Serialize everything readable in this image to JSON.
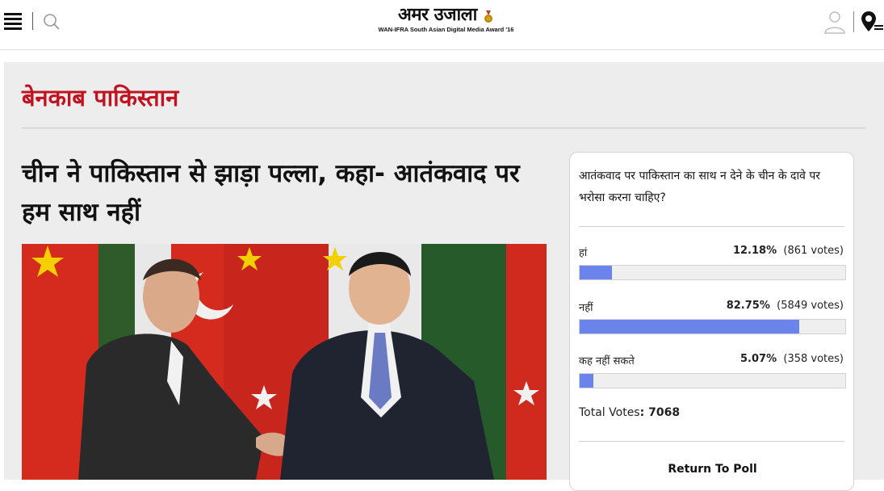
{
  "header": {
    "logo_text": "अमर उजाला",
    "logo_tagline": "WAN-IFRA South Asian Digital Media Award '16"
  },
  "section": {
    "title": "बेनकाब पाकिस्तान"
  },
  "article": {
    "headline": "चीन ने पाकिस्तान से झाड़ा पल्ला, कहा- आतंकवाद पर हम साथ नहीं"
  },
  "poll": {
    "question": "आतंकवाद पर पाकिस्तान का साथ न देने के चीन के दावे पर भरोसा करना चाहिए?",
    "options": [
      {
        "label": "हां",
        "percent_text": "12.18%",
        "votes_text": "(861 votes)",
        "percent": 12.18
      },
      {
        "label": "नहीं",
        "percent_text": "82.75%",
        "votes_text": "(5849 votes)",
        "percent": 82.75
      },
      {
        "label": "कह नहीं सकते",
        "percent_text": "5.07%",
        "votes_text": "(358 votes)",
        "percent": 5.07
      }
    ],
    "total_label": "Total Votes",
    "total_value": "7068",
    "return_label": "Return To Poll",
    "bar_color": "#6b84ec"
  },
  "colors": {
    "section_red": "#c1121f",
    "panel_bg": "#ededed"
  },
  "icons": [
    "menu-icon",
    "search-icon",
    "user-icon",
    "location-icon",
    "medal-icon"
  ]
}
